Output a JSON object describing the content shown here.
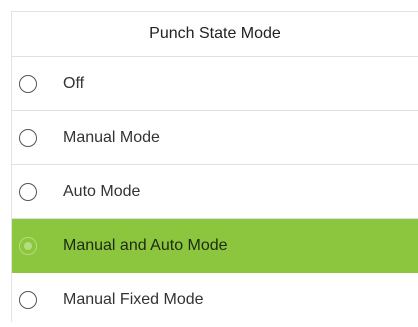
{
  "title": "Punch State Mode",
  "options": [
    {
      "label": "Off",
      "selected": false
    },
    {
      "label": "Manual Mode",
      "selected": false
    },
    {
      "label": "Auto Mode",
      "selected": false
    },
    {
      "label": "Manual and Auto Mode",
      "selected": true
    },
    {
      "label": "Manual Fixed Mode",
      "selected": false
    }
  ],
  "colors": {
    "selected_background": "#8cc63e",
    "radio_selected": "#b5dd7f"
  }
}
